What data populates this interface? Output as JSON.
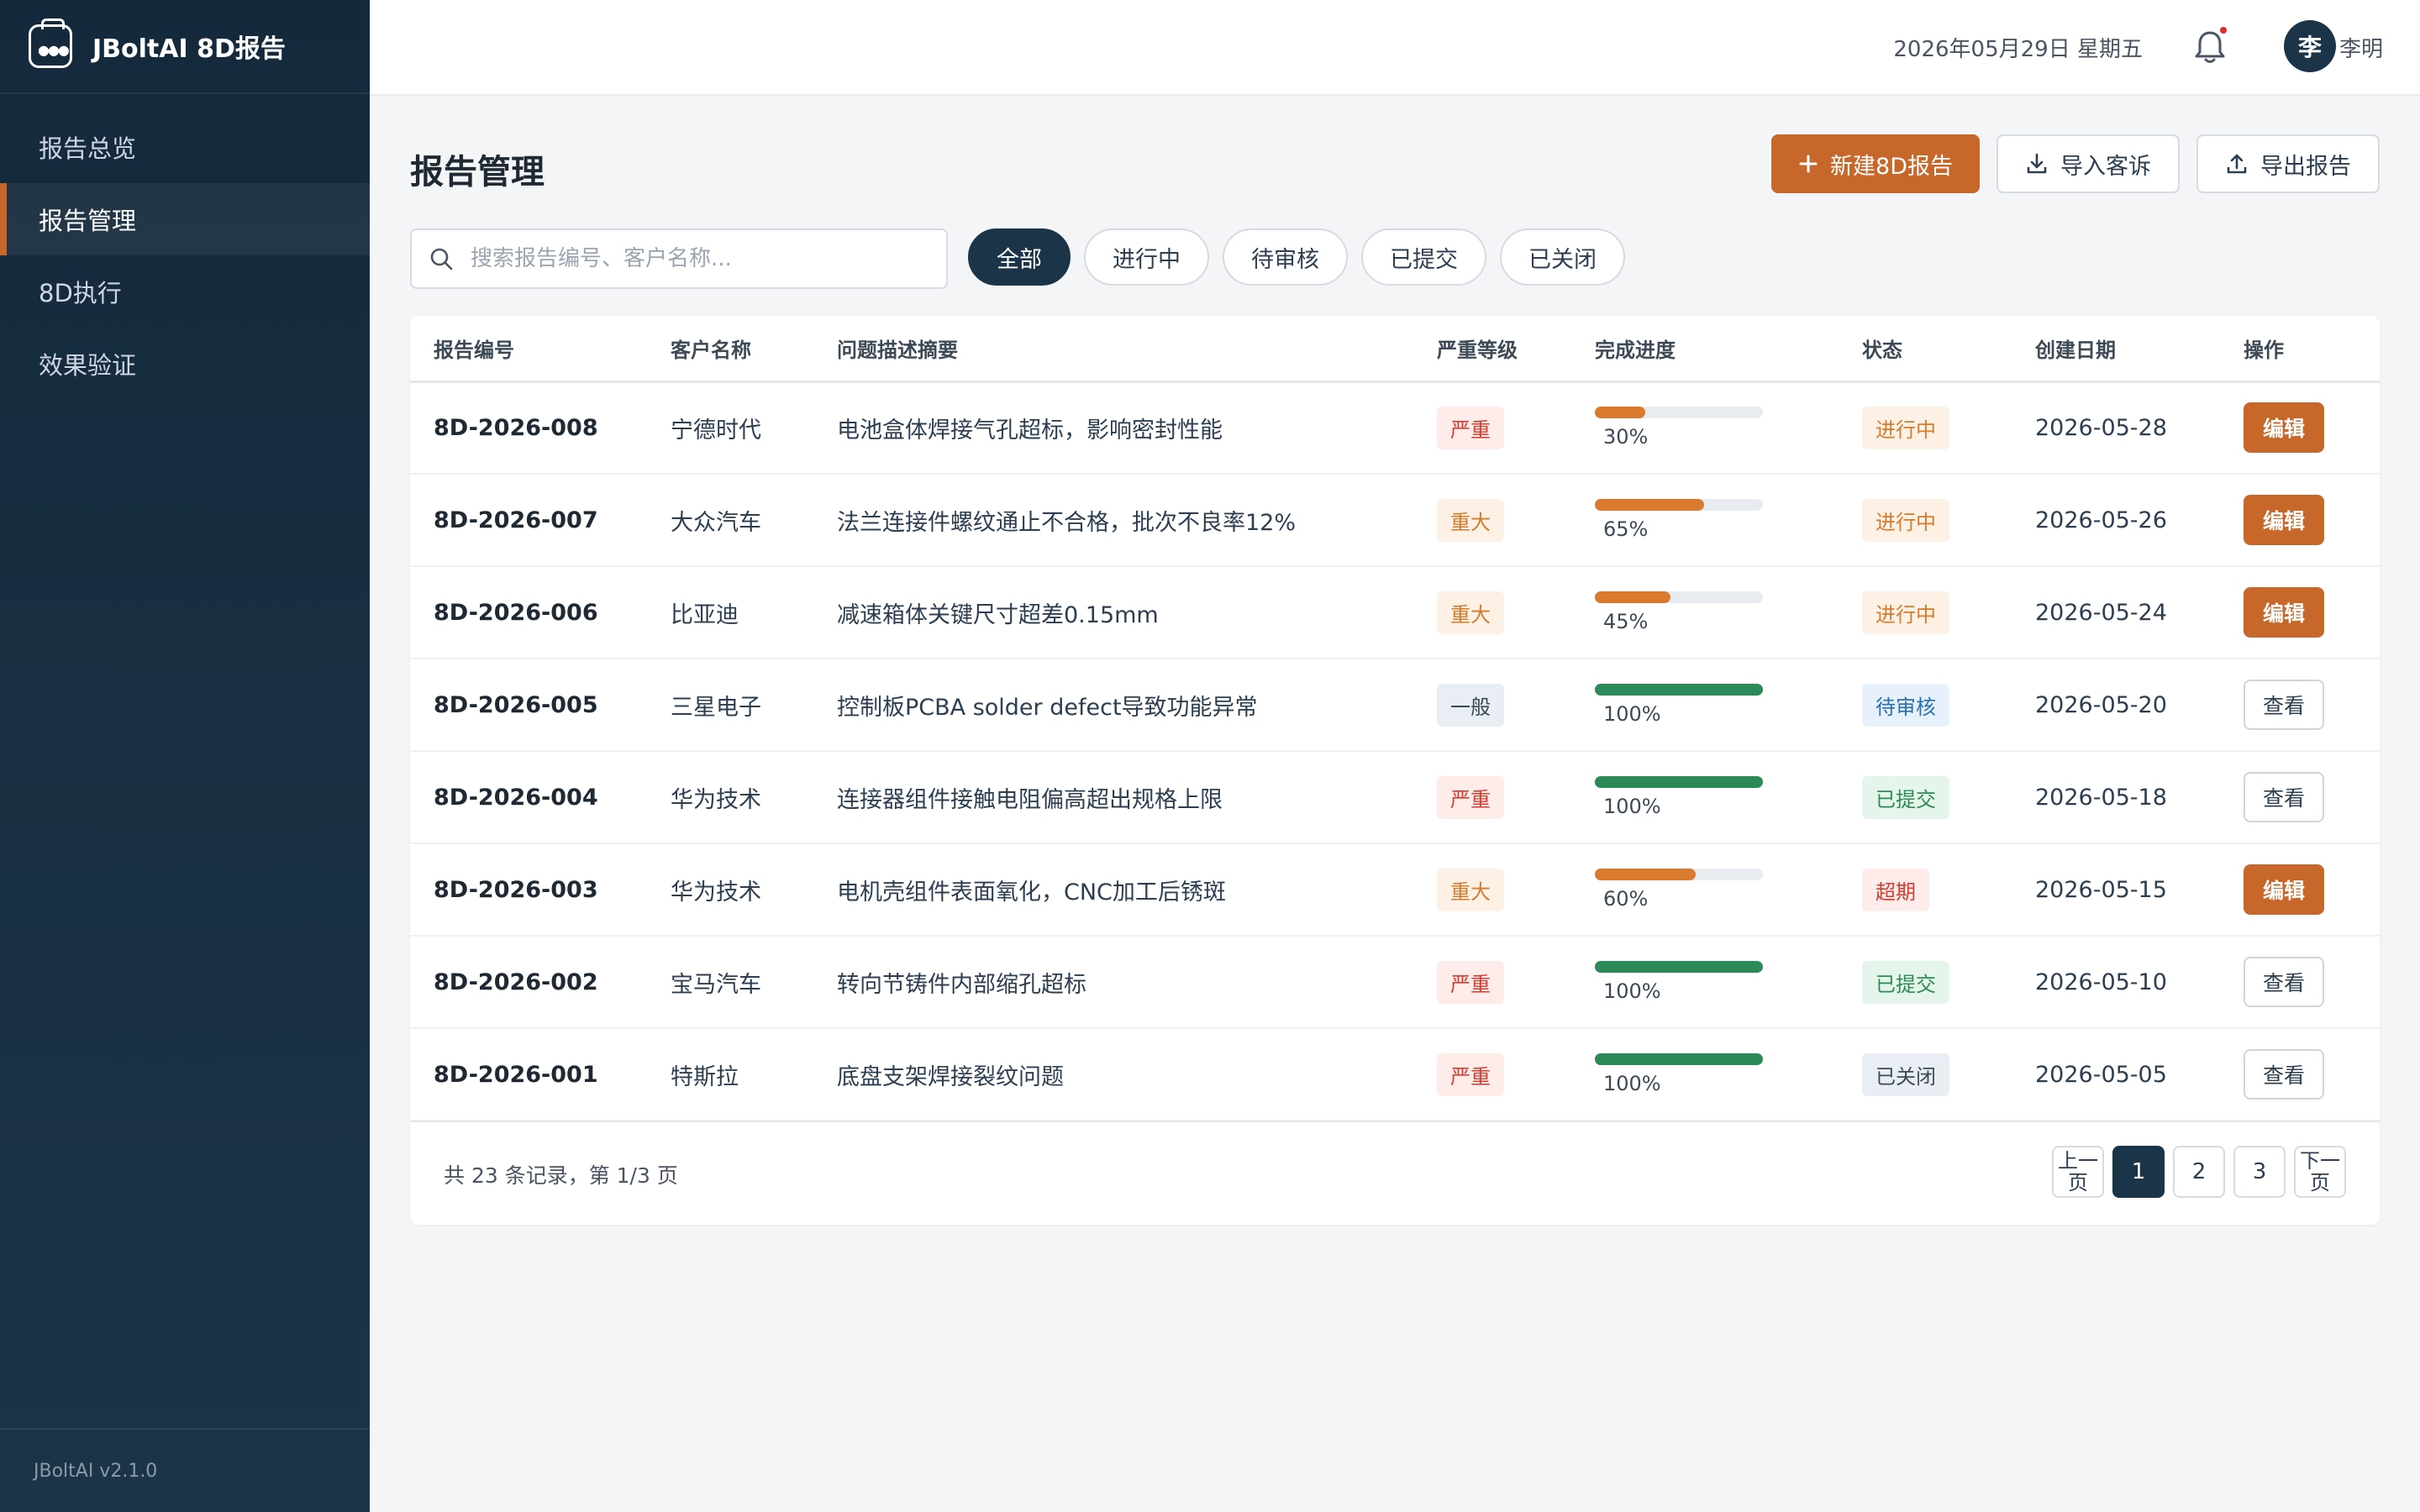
{
  "app": {
    "brand": "JBoltAI 8D报告",
    "version": "JBoltAI v2.1.0"
  },
  "sidebar": {
    "items": [
      {
        "label": "报告总览",
        "active": false
      },
      {
        "label": "报告管理",
        "active": true
      },
      {
        "label": "8D执行",
        "active": false
      },
      {
        "label": "效果验证",
        "active": false
      }
    ]
  },
  "header": {
    "date": "2026年05月29日 星期五",
    "avatar_initial": "李",
    "user_name": "李明"
  },
  "page": {
    "title": "报告管理",
    "actions": {
      "new_report": "新建8D报告",
      "import": "导入客诉",
      "export": "导出报告"
    },
    "search_placeholder": "搜索报告编号、客户名称...",
    "filters": [
      "全部",
      "进行中",
      "待审核",
      "已提交",
      "已关闭"
    ]
  },
  "table": {
    "columns": [
      "报告编号",
      "客户名称",
      "问题描述摘要",
      "严重等级",
      "完成进度",
      "状态",
      "创建日期",
      "操作"
    ],
    "rows": [
      {
        "code": "8D-2026-008",
        "customer": "宁德时代",
        "summary": "电池盒体焊接气孔超标，影响密封性能",
        "severity": "严重",
        "progress": 30,
        "progress_label": "30%",
        "status": "进行中",
        "date": "2026-05-28",
        "op": "编辑"
      },
      {
        "code": "8D-2026-007",
        "customer": "大众汽车",
        "summary": "法兰连接件螺纹通止不合格，批次不良率12%",
        "severity": "重大",
        "progress": 65,
        "progress_label": "65%",
        "status": "进行中",
        "date": "2026-05-26",
        "op": "编辑"
      },
      {
        "code": "8D-2026-006",
        "customer": "比亚迪",
        "summary": "减速箱体关键尺寸超差0.15mm",
        "severity": "重大",
        "progress": 45,
        "progress_label": "45%",
        "status": "进行中",
        "date": "2026-05-24",
        "op": "编辑"
      },
      {
        "code": "8D-2026-005",
        "customer": "三星电子",
        "summary": "控制板PCBA solder defect导致功能异常",
        "severity": "一般",
        "progress": 100,
        "progress_label": "100%",
        "status": "待审核",
        "date": "2026-05-20",
        "op": "查看"
      },
      {
        "code": "8D-2026-004",
        "customer": "华为技术",
        "summary": "连接器组件接触电阻偏高超出规格上限",
        "severity": "严重",
        "progress": 100,
        "progress_label": "100%",
        "status": "已提交",
        "date": "2026-05-18",
        "op": "查看"
      },
      {
        "code": "8D-2026-003",
        "customer": "华为技术",
        "summary": "电机壳组件表面氧化，CNC加工后锈斑",
        "severity": "重大",
        "progress": 60,
        "progress_label": "60%",
        "status": "超期",
        "date": "2026-05-15",
        "op": "编辑"
      },
      {
        "code": "8D-2026-002",
        "customer": "宝马汽车",
        "summary": "转向节铸件内部缩孔超标",
        "severity": "严重",
        "progress": 100,
        "progress_label": "100%",
        "status": "已提交",
        "date": "2026-05-10",
        "op": "查看"
      },
      {
        "code": "8D-2026-001",
        "customer": "特斯拉",
        "summary": "底盘支架焊接裂纹问题",
        "severity": "严重",
        "progress": 100,
        "progress_label": "100%",
        "status": "已关闭",
        "date": "2026-05-05",
        "op": "查看"
      }
    ]
  },
  "pagination": {
    "summary": "共 23 条记录，第 1/3 页",
    "prev": "上一页",
    "next": "下一页",
    "pages": [
      "1",
      "2",
      "3"
    ],
    "current": "1"
  },
  "colors": {
    "accent": "#c8672a",
    "navy": "#1b3448",
    "success": "#2b8a57",
    "danger": "#d23f31"
  },
  "icons": {
    "brand": "robot-logo-icon",
    "bell": "bell-icon",
    "search": "search-icon",
    "plus": "plus-icon",
    "import": "download-icon",
    "export": "upload-icon"
  }
}
